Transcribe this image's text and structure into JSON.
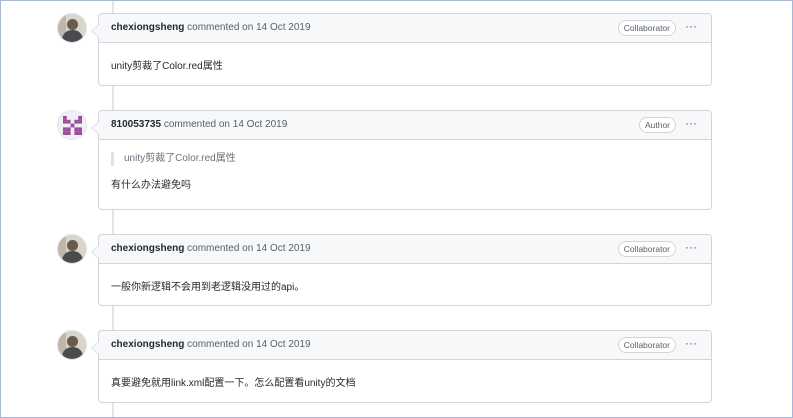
{
  "comments": [
    {
      "author": "chexiongsheng",
      "meta": "commented on 14 Oct 2019",
      "badge": "Collaborator",
      "more": "···",
      "quote": null,
      "body": "unity剪裁了Color.red属性"
    },
    {
      "author": "810053735",
      "meta": "commented on 14 Oct 2019",
      "badge": "Author",
      "more": "···",
      "quote": "unity剪裁了Color.red属性",
      "body": "有什么办法避免吗"
    },
    {
      "author": "chexiongsheng",
      "meta": "commented on 14 Oct 2019",
      "badge": "Collaborator",
      "more": "···",
      "quote": null,
      "body": "一般你新逻辑不会用到老逻辑没用过的api。"
    },
    {
      "author": "chexiongsheng",
      "meta": "commented on 14 Oct 2019",
      "badge": "Collaborator",
      "more": "···",
      "quote": null,
      "body": "真要避免就用link.xml配置一下。怎么配置看unity的文档"
    }
  ],
  "colors": {
    "identicon": "#9b4f96",
    "border": "#d1d5da",
    "header_bg": "#f6f8fa",
    "timeline": "#e1e4e8"
  },
  "icons": {
    "avatar_collaborator": "user-photo-avatar",
    "avatar_author": "identicon-avatar",
    "more": "kebab-horizontal-icon"
  }
}
